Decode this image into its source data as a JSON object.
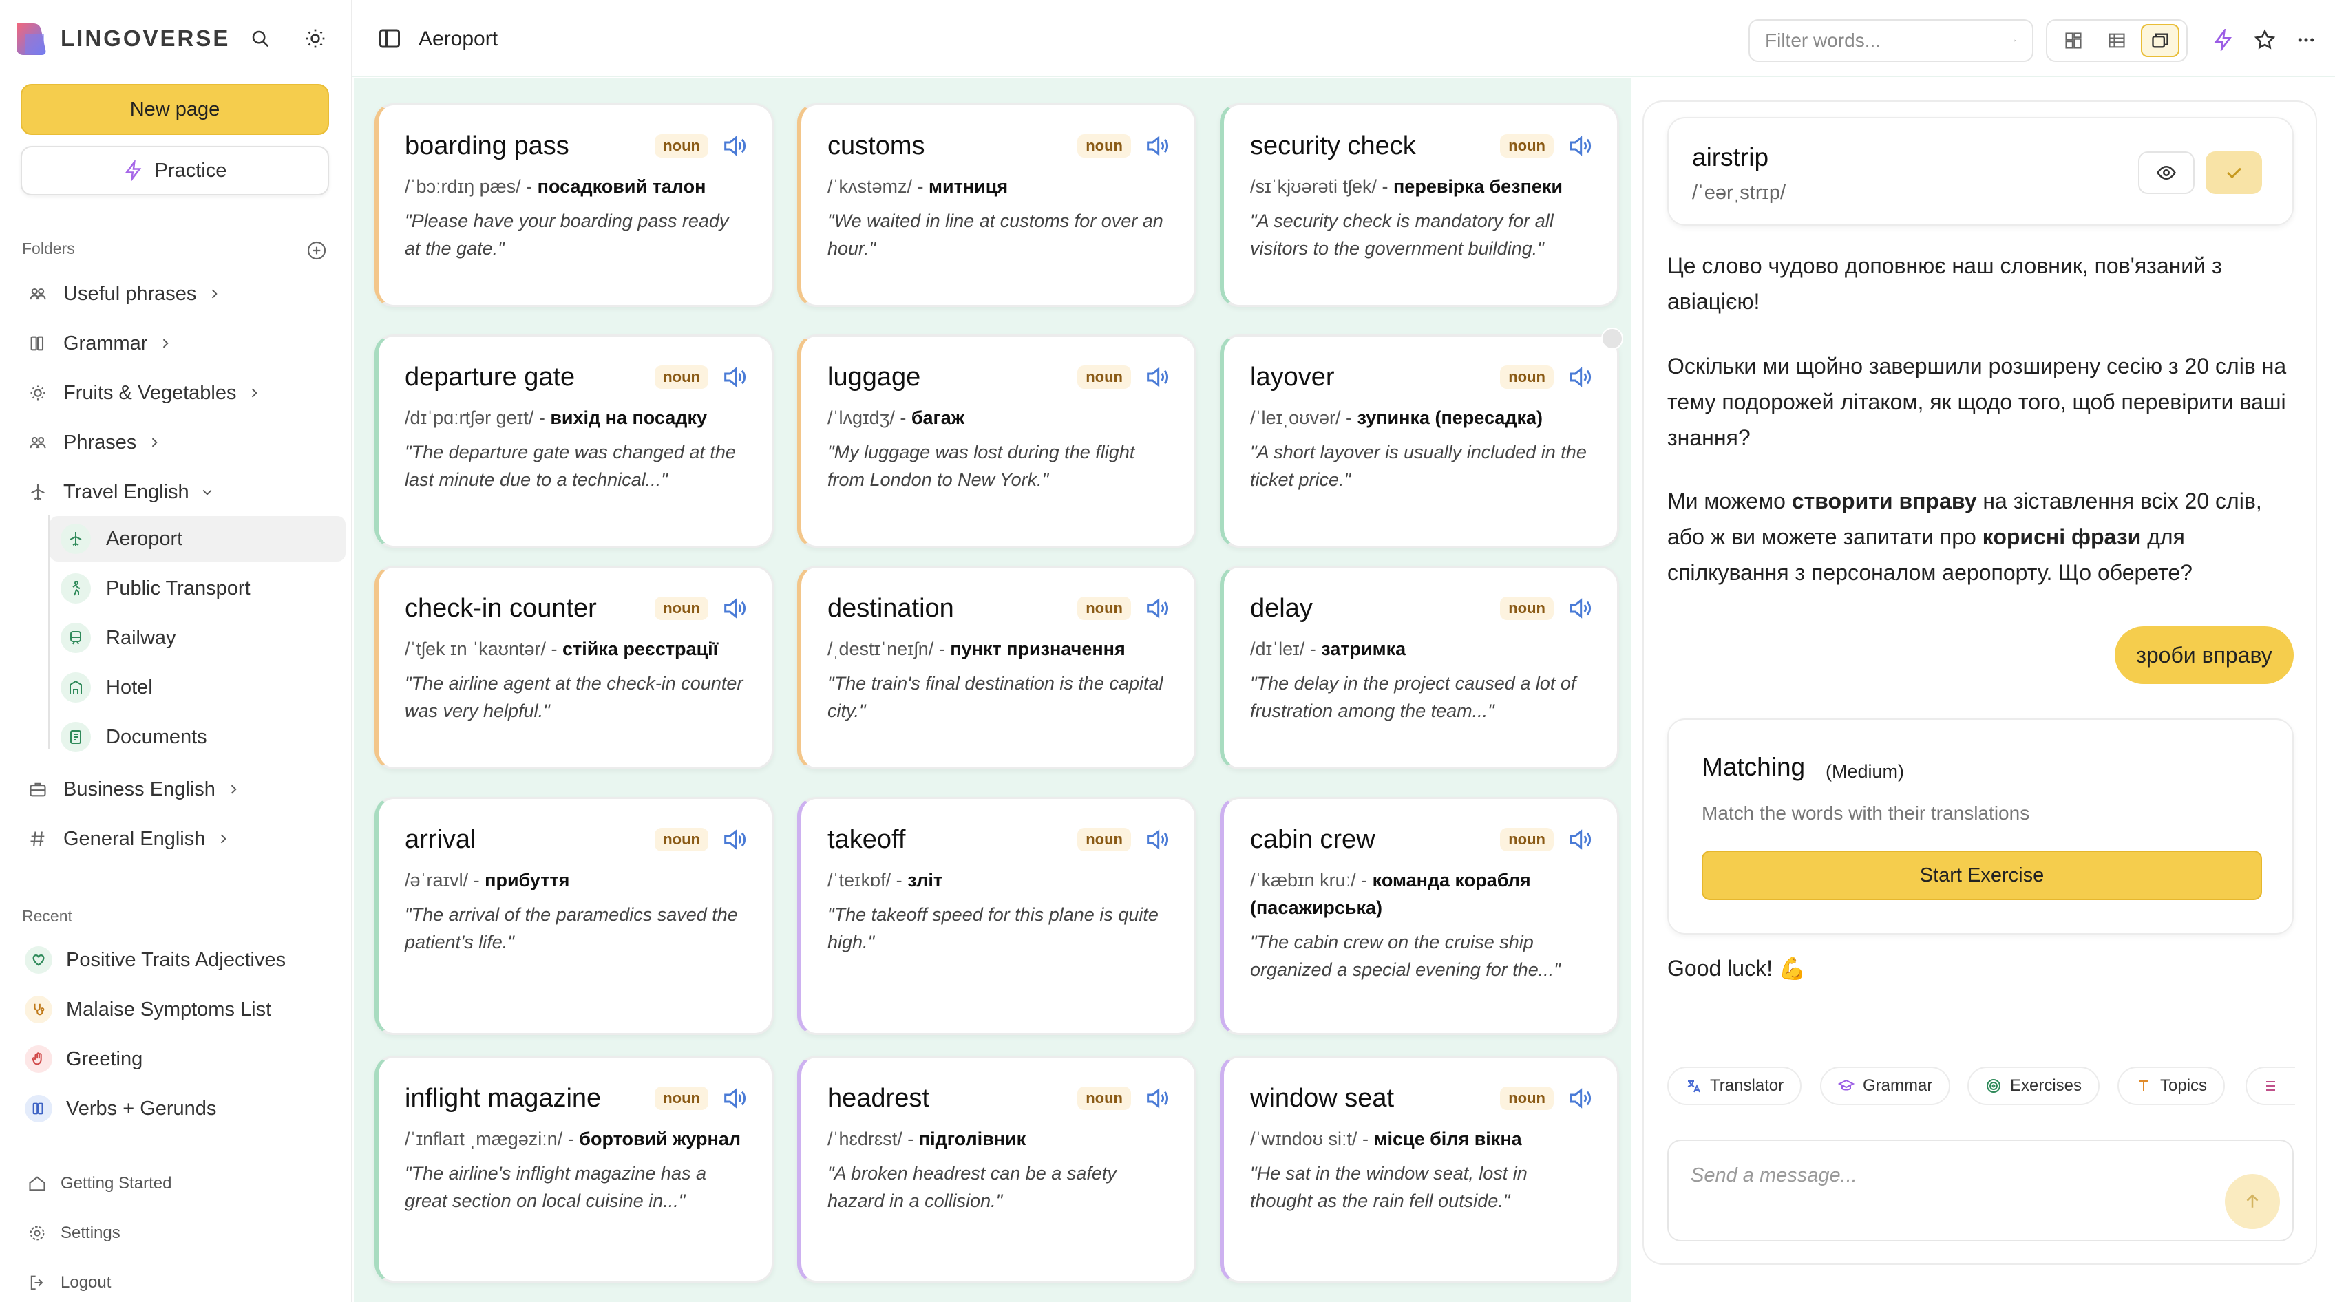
{
  "app": {
    "name": "LINGOVERSE"
  },
  "sidebar": {
    "new_page": "New page",
    "practice": "Practice",
    "folders_label": "Folders",
    "folders": [
      {
        "label": "Useful phrases"
      },
      {
        "label": "Grammar"
      },
      {
        "label": "Fruits & Vegetables"
      },
      {
        "label": "Phrases"
      },
      {
        "label": "Travel English"
      },
      {
        "label": "Business English"
      },
      {
        "label": "General English"
      }
    ],
    "travel_sub": [
      {
        "label": "Aeroport",
        "icon": "plane-icon"
      },
      {
        "label": "Public Transport",
        "icon": "walking-icon"
      },
      {
        "label": "Railway",
        "icon": "train-icon"
      },
      {
        "label": "Hotel",
        "icon": "hotel-icon"
      },
      {
        "label": "Documents",
        "icon": "document-icon"
      }
    ],
    "recent_label": "Recent",
    "recent": [
      {
        "label": "Positive Traits Adjectives"
      },
      {
        "label": "Malaise Symptoms List"
      },
      {
        "label": "Greeting"
      },
      {
        "label": "Verbs + Gerunds"
      }
    ],
    "footer": {
      "getting_started": "Getting Started",
      "settings": "Settings",
      "logout": "Logout"
    }
  },
  "header": {
    "breadcrumb": "Aeroport",
    "filter_placeholder": "Filter words..."
  },
  "cards": [
    {
      "word": "boarding pass",
      "pos": "noun",
      "pron": "/ˈbɔːrdɪŋ pæs/",
      "translation": "посадковий талон",
      "example": "\"Please have your boarding pass ready at the gate.\""
    },
    {
      "word": "customs",
      "pos": "noun",
      "pron": "/ˈkʌstəmz/",
      "translation": "митниця",
      "example": "\"We waited in line at customs for over an hour.\""
    },
    {
      "word": "security check",
      "pos": "noun",
      "pron": "/sɪˈkjʊərəti tʃek/",
      "translation": "перевірка безпеки",
      "example": "\"A security check is mandatory for all visitors to the government building.\""
    },
    {
      "word": "departure gate",
      "pos": "noun",
      "pron": "/dɪˈpɑːrtʃər ɡeɪt/",
      "translation": "вихід на посадку",
      "example": "\"The departure gate was changed at the last minute due to a technical...\""
    },
    {
      "word": "luggage",
      "pos": "noun",
      "pron": "/ˈlʌɡɪdʒ/",
      "translation": "багаж",
      "example": "\"My luggage was lost during the flight from London to New York.\""
    },
    {
      "word": "layover",
      "pos": "noun",
      "pron": "/ˈleɪˌoʊvər/",
      "translation": "зупинка (пересадка)",
      "example": "\"A short layover is usually included in the ticket price.\""
    },
    {
      "word": "check-in counter",
      "pos": "noun",
      "pron": "/ˈtʃek ɪn ˈkaʊntər/",
      "translation": "стійка реєстрації",
      "example": "\"The airline agent at the check-in counter was very helpful.\""
    },
    {
      "word": "destination",
      "pos": "noun",
      "pron": "/ˌdestɪˈneɪʃn/",
      "translation": "пункт призначення",
      "example": "\"The train's final destination is the capital city.\""
    },
    {
      "word": "delay",
      "pos": "noun",
      "pron": "/dɪˈleɪ/",
      "translation": "затримка",
      "example": "\"The delay in the project caused a lot of frustration among the team...\""
    },
    {
      "word": "arrival",
      "pos": "noun",
      "pron": "/əˈraɪvl/",
      "translation": "прибуття",
      "example": "\"The arrival of the paramedics saved the patient's life.\""
    },
    {
      "word": "takeoff",
      "pos": "noun",
      "pron": "/ˈteɪkɒf/",
      "translation": "зліт",
      "example": "\"The takeoff speed for this plane is quite high.\""
    },
    {
      "word": "cabin crew",
      "pos": "noun",
      "pron": "/ˈkæbɪn kruː/",
      "translation": "команда корабля (пасажирська)",
      "example": "\"The cabin crew on the cruise ship organized a special evening for the...\""
    },
    {
      "word": "inflight magazine",
      "pos": "noun",
      "pron": "/ˈɪnflaɪt ˌmæɡəziːn/",
      "translation": "бортовий журнал",
      "example": "\"The airline's inflight magazine has a great section on local cuisine in...\""
    },
    {
      "word": "headrest",
      "pos": "noun",
      "pron": "/ˈhɛdrɛst/",
      "translation": "підголівник",
      "example": "\"A broken headrest can be a safety hazard in a collision.\""
    },
    {
      "word": "window seat",
      "pos": "noun",
      "pron": "/ˈwɪndoʊ siːt/",
      "translation": "місце біля вікна",
      "example": "\"He sat in the window seat, lost in thought as the rain fell outside.\""
    }
  ],
  "chat": {
    "word": "airstrip",
    "pron": "/ˈeərˌstrɪp/",
    "msg1": "Це слово чудово доповнює наш словник, пов'язаний з авіацією!",
    "msg2": "Оскільки ми щойно завершили розширену сесію з 20 слів на тему подорожей літаком, як щодо того, щоб перевірити ваші знання?",
    "msg3_a": "Ми можемо ",
    "msg3_b": "створити вправу",
    "msg3_c": " на зіставлення всіх 20 слів, або ж ви можете запитати про ",
    "msg3_d": "корисні фрази",
    "msg3_e": " для спілкування з персоналом аеропорту. Що оберете?",
    "action": "зроби вправу",
    "exercise": {
      "title": "Matching",
      "level": "(Medium)",
      "desc": "Match the words with their translations",
      "start": "Start Exercise"
    },
    "luck": "Good luck! 💪",
    "chips": [
      {
        "label": "Translator",
        "icon": "translate-icon"
      },
      {
        "label": "Grammar",
        "icon": "graduation-cap-icon"
      },
      {
        "label": "Exercises",
        "icon": "target-icon"
      },
      {
        "label": "Topics",
        "icon": "tag-icon"
      }
    ],
    "placeholder": "Send a message..."
  },
  "colors": {
    "accent": "#f5cd4d",
    "main_bg": "#e9f6f0",
    "orange_border": "#f3c68a",
    "green_border": "#a8dcc0",
    "purple_border": "#cdb1f0"
  }
}
